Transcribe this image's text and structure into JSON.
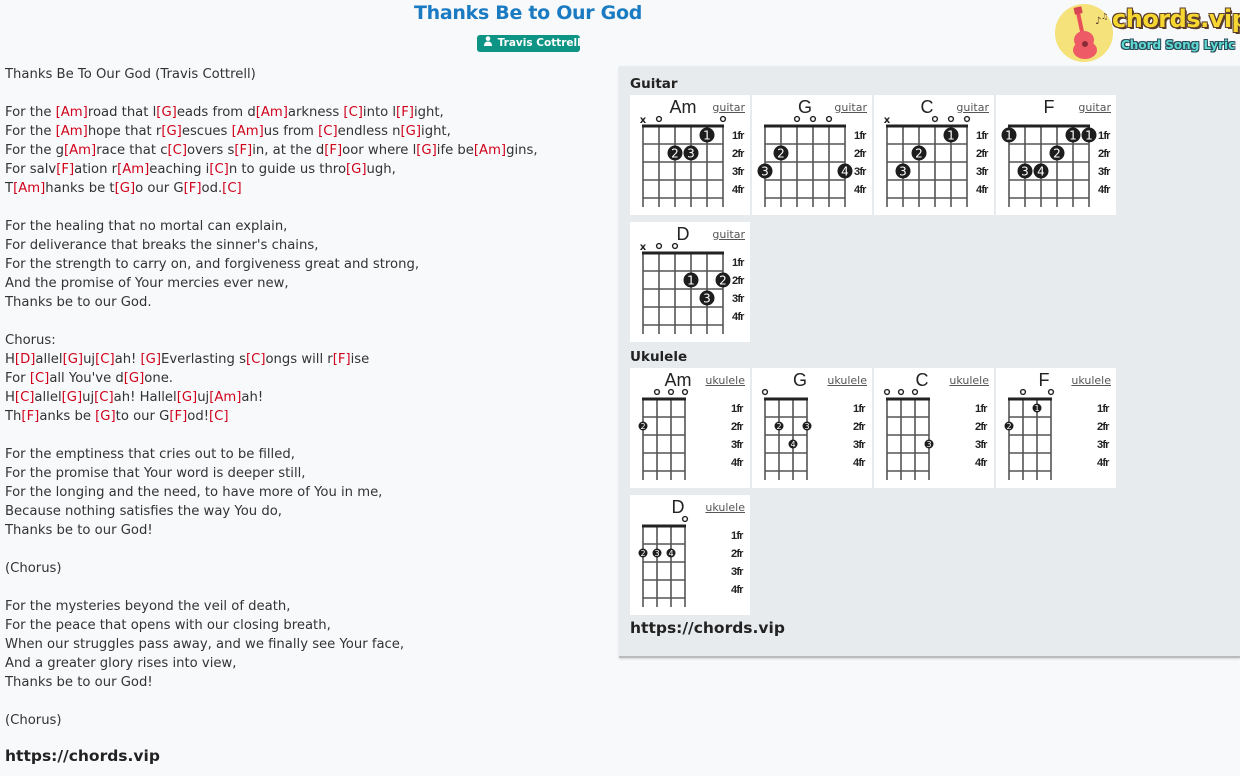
{
  "header": {
    "title": "Thanks Be to Our God",
    "artist": "Travis Cottrell",
    "artist_icon": "user-icon"
  },
  "logo": {
    "name": "chords.vip",
    "tagline": "Chord Song Lyric",
    "icon": "guitar-music-icon"
  },
  "lyrics": {
    "lines": [
      "Thanks Be To Our God (Travis Cottrell)",
      "",
      "For the [Am]road that l[G]eads from d[Am]arkness [C]into l[F]ight,",
      "For the [Am]hope that r[G]escues [Am]us from [C]endless n[G]ight,",
      "For the g[Am]race that c[C]overs s[F]in, at the d[F]oor where l[G]ife be[Am]gins,",
      "For salv[F]ation r[Am]eaching i[C]n to guide us thro[G]ugh,",
      "T[Am]hanks be t[G]o our G[F]od.[C]",
      "",
      "For the healing that no mortal can explain,",
      "For deliverance that breaks the sinner's chains,",
      "For the strength to carry on, and forgiveness great and strong,",
      "And the promise of Your mercies ever new,",
      "Thanks be to our God.",
      "",
      "Chorus:",
      "H[D]allel[G]uj[C]ah! [G]Everlasting s[C]ongs will r[F]ise",
      "For [C]all You've d[G]one.",
      "H[C]allel[G]uj[C]ah! Hallel[G]uj[Am]ah!",
      "Th[F]anks be [G]to our G[F]od![C]",
      "",
      "For the emptiness that cries out to be filled,",
      "For the promise that Your word is deeper still,",
      "For the longing and the need, to have more of You in me,",
      "Because nothing satisfies the way You do,",
      "Thanks be to our God!",
      "",
      "(Chorus)",
      "",
      "For the mysteries beyond the veil of death,",
      "For the peace that opens with our closing breath,",
      "When our struggles pass away, and we finally see Your face,",
      "And a greater glory rises into view,",
      "Thanks be to our God!",
      "",
      "(Chorus)"
    ],
    "footer_url": "https://chords.vip"
  },
  "panel": {
    "guitar_heading": "Guitar",
    "ukulele_heading": "Ukulele",
    "url": "https://chords.vip",
    "fret_labels": [
      "1fr",
      "2fr",
      "3fr",
      "4fr"
    ],
    "guitar_chords": [
      {
        "name": "Am",
        "link": "guitar",
        "markers": [
          "x",
          "o",
          "",
          "",
          "",
          "o"
        ],
        "fingers": [
          {
            "s": 5,
            "f": 1,
            "n": "1"
          },
          {
            "s": 3,
            "f": 2,
            "n": "2"
          },
          {
            "s": 4,
            "f": 2,
            "n": "3"
          }
        ],
        "barre": []
      },
      {
        "name": "G",
        "link": "guitar",
        "markers": [
          "",
          "",
          "o",
          "o",
          "o",
          ""
        ],
        "fingers": [
          {
            "s": 2,
            "f": 2,
            "n": "2"
          },
          {
            "s": 1,
            "f": 3,
            "n": "3"
          },
          {
            "s": 6,
            "f": 3,
            "n": "4"
          }
        ],
        "barre": []
      },
      {
        "name": "C",
        "link": "guitar",
        "markers": [
          "x",
          "",
          "",
          "",
          "o",
          ""
        ],
        "markers_alt": {
          "4": "o",
          "6": "o"
        },
        "fingers": [
          {
            "s": 5,
            "f": 1,
            "n": "1"
          },
          {
            "s": 3,
            "f": 2,
            "n": "2"
          },
          {
            "s": 2,
            "f": 3,
            "n": "3"
          }
        ],
        "barre": []
      },
      {
        "name": "F",
        "link": "guitar",
        "markers": [
          "",
          "",
          "",
          "",
          "",
          ""
        ],
        "fingers": [
          {
            "s": 1,
            "f": 1,
            "n": "1"
          },
          {
            "s": 5,
            "f": 1,
            "n": "1"
          },
          {
            "s": 6,
            "f": 1,
            "n": "1"
          },
          {
            "s": 4,
            "f": 2,
            "n": "2"
          },
          {
            "s": 2,
            "f": 3,
            "n": "3"
          },
          {
            "s": 3,
            "f": 3,
            "n": "4"
          }
        ],
        "barre": []
      },
      {
        "name": "D",
        "link": "guitar",
        "markers": [
          "x",
          "o",
          "o",
          "",
          "",
          ""
        ],
        "fingers": [
          {
            "s": 4,
            "f": 2,
            "n": "1"
          },
          {
            "s": 6,
            "f": 2,
            "n": "2"
          },
          {
            "s": 5,
            "f": 3,
            "n": "3"
          }
        ],
        "barre": []
      }
    ],
    "ukulele_chords": [
      {
        "name": "Am",
        "link": "ukulele",
        "markers": [
          "",
          "o",
          "o",
          "o"
        ],
        "fingers": [
          {
            "s": 1,
            "f": 2,
            "n": "2"
          }
        ]
      },
      {
        "name": "G",
        "link": "ukulele",
        "markers": [
          "o",
          "",
          "",
          ""
        ],
        "fingers": [
          {
            "s": 2,
            "f": 2,
            "n": "2"
          },
          {
            "s": 4,
            "f": 2,
            "n": "3"
          },
          {
            "s": 3,
            "f": 3,
            "n": "4"
          }
        ]
      },
      {
        "name": "C",
        "link": "ukulele",
        "markers": [
          "o",
          "o",
          "o",
          ""
        ],
        "fingers": [
          {
            "s": 4,
            "f": 3,
            "n": "3"
          }
        ]
      },
      {
        "name": "F",
        "link": "ukulele",
        "markers": [
          "",
          "o",
          "",
          "o"
        ],
        "fingers": [
          {
            "s": 3,
            "f": 1,
            "n": "1"
          },
          {
            "s": 1,
            "f": 2,
            "n": "2"
          }
        ]
      },
      {
        "name": "D",
        "link": "ukulele",
        "markers": [
          "",
          "",
          "",
          "o"
        ],
        "fingers": [
          {
            "s": 1,
            "f": 2,
            "n": "2"
          },
          {
            "s": 2,
            "f": 2,
            "n": "3"
          },
          {
            "s": 3,
            "f": 2,
            "n": "4"
          }
        ]
      }
    ]
  },
  "colors": {
    "title": "#1a7ac2",
    "artist_badge": "#0e9484",
    "chord_text": "#d0021b",
    "panel_bg": "#e8ebee"
  }
}
